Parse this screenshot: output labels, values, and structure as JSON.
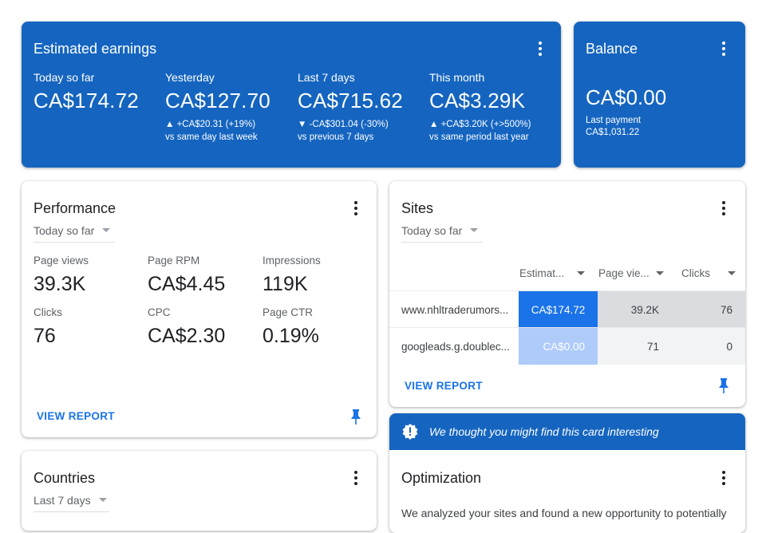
{
  "earnings": {
    "title": "Estimated earnings",
    "columns": [
      {
        "label": "Today so far",
        "value": "CA$174.72",
        "delta": "",
        "compare": ""
      },
      {
        "label": "Yesterday",
        "value": "CA$127.70",
        "delta": "▲ +CA$20.31 (+19%)",
        "compare": "vs same day last week"
      },
      {
        "label": "Last 7 days",
        "value": "CA$715.62",
        "delta": "▼ -CA$301.04 (-30%)",
        "compare": "vs previous 7 days"
      },
      {
        "label": "This month",
        "value": "CA$3.29K",
        "delta": "▲ +CA$3.20K (+>500%)",
        "compare": "vs same period last year"
      }
    ]
  },
  "balance": {
    "title": "Balance",
    "value": "CA$0.00",
    "last_payment_label": "Last payment",
    "last_payment_value": "CA$1,031.22"
  },
  "performance": {
    "title": "Performance",
    "range": "Today so far",
    "metrics": [
      {
        "label": "Page views",
        "value": "39.3K"
      },
      {
        "label": "Page RPM",
        "value": "CA$4.45"
      },
      {
        "label": "Impressions",
        "value": "119K"
      },
      {
        "label": "Clicks",
        "value": "76"
      },
      {
        "label": "CPC",
        "value": "CA$2.30"
      },
      {
        "label": "Page CTR",
        "value": "0.19%"
      }
    ],
    "view_report": "VIEW REPORT"
  },
  "sites": {
    "title": "Sites",
    "range": "Today so far",
    "columns": [
      "Estimat...",
      "Page vie...",
      "Clicks"
    ],
    "rows": [
      {
        "site": "www.nhltraderumors...",
        "estimated": "CA$174.72",
        "page_views": "39.2K",
        "clicks": "76"
      },
      {
        "site": "googleads.g.doublec...",
        "estimated": "CA$0.00",
        "page_views": "71",
        "clicks": "0"
      }
    ],
    "view_report": "VIEW REPORT"
  },
  "countries": {
    "title": "Countries",
    "range": "Last 7 days"
  },
  "optimization": {
    "banner": "We thought you might find this card interesting",
    "title": "Optimization",
    "body": "We analyzed your sites and found a new opportunity to potentially"
  },
  "colors": {
    "primary_blue": "#1565c0",
    "link_blue": "#1a73e8",
    "heat_strong": "#1a73e8",
    "heat_light": "#aecbfa",
    "row_gray_1": "#dadce0",
    "row_gray_2": "#f1f3f4"
  }
}
